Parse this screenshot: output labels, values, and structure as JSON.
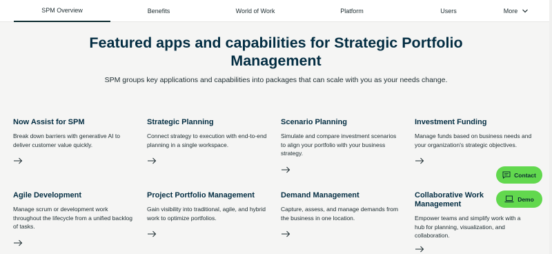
{
  "tabs": [
    {
      "label": "SPM Overview"
    },
    {
      "label": "Benefits"
    },
    {
      "label": "World of Work"
    },
    {
      "label": "Platform"
    },
    {
      "label": "Users"
    },
    {
      "label": "More"
    }
  ],
  "hero": {
    "title": "Featured apps and capabilities for Strategic Portfolio Management",
    "subtitle": "SPM groups key applications and capabilities into packages that can scale with you as your needs change."
  },
  "cards": [
    {
      "title": "Now Assist for SPM",
      "desc": "Break down barriers with generative AI to deliver customer value quickly."
    },
    {
      "title": "Strategic Planning",
      "desc": "Connect strategy to execution with end-to-end planning in a single workspace."
    },
    {
      "title": "Scenario Planning",
      "desc": "Simulate and compare investment scenarios to align your portfolio with your business strategy."
    },
    {
      "title": "Investment Funding",
      "desc": "Manage funds based on business needs and your organization's strategic objectives."
    },
    {
      "title": "Agile Development",
      "desc": "Manage scrum or development work throughout the lifecycle from a unified backlog of tasks."
    },
    {
      "title": "Project Portfolio Management",
      "desc": "Gain visibility into traditional, agile, and hybrid work to optimize portfolios."
    },
    {
      "title": "Demand Management",
      "desc": "Capture, assess, and manage demands from the business in one location."
    },
    {
      "title": "Collaborative Work Management",
      "desc": "Empower teams and simplify work with a hub for planning, visualization, and collaboration."
    }
  ],
  "floating": {
    "contact_label": "Contact",
    "demo_label": "Demo"
  },
  "colors": {
    "heading": "#032d42",
    "accent_green": "#62d84e",
    "background": "#f5f5f4"
  }
}
